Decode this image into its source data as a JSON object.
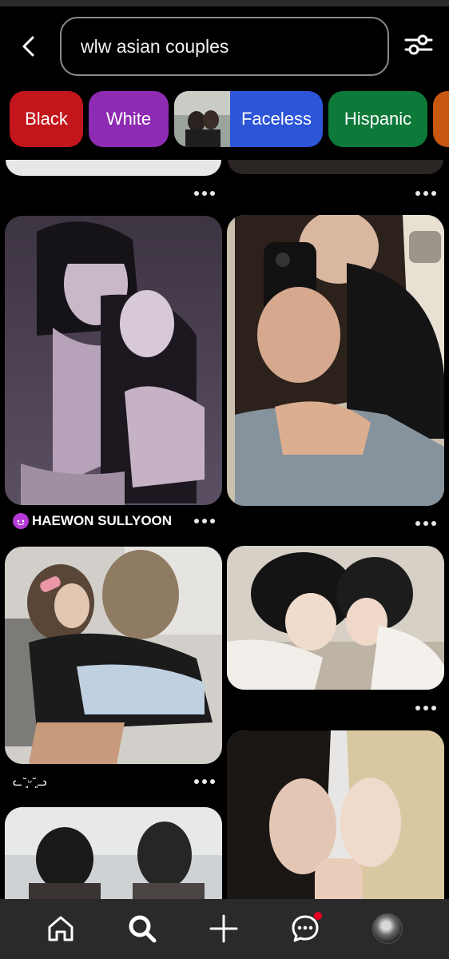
{
  "search": {
    "query": "wlw asian couples"
  },
  "chips": [
    {
      "label": "Black",
      "color": "#c3161c"
    },
    {
      "label": "White",
      "color": "#8e2bb3"
    },
    {
      "label": "Faceless",
      "color": "#2c55d8"
    },
    {
      "label": "Hispanic",
      "color": "#0d7a3a"
    }
  ],
  "pins": {
    "p1_caption": "HAEWON SULLYOON",
    "p5_caption": "ᓚ˘͈ᵕ˘͈ᓗ"
  },
  "colors": {
    "background": "#000000",
    "nav_bg": "#2a2a2a",
    "notification": "#e60023"
  },
  "icons": [
    "back-arrow-icon",
    "filter-sliders-icon",
    "home-icon",
    "search-icon",
    "plus-icon",
    "messages-icon",
    "avatar"
  ]
}
